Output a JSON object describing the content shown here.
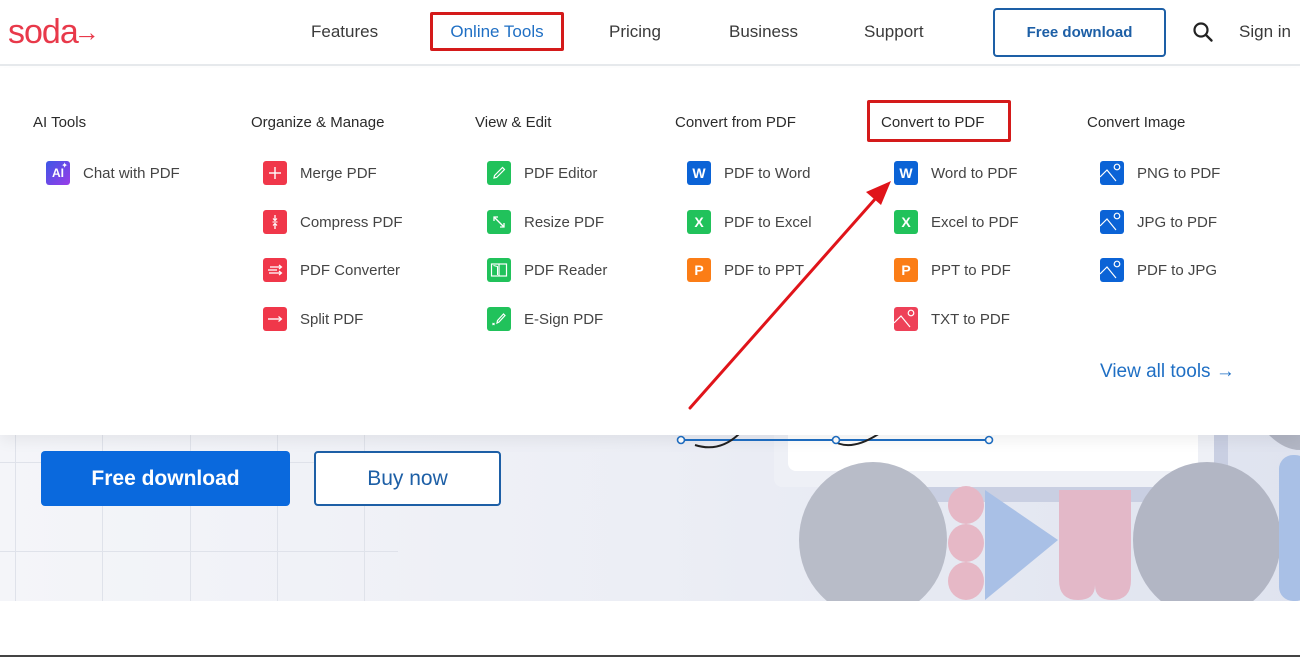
{
  "header": {
    "logo": "soda",
    "logo_arrow": "→",
    "nav": [
      "Features",
      "Online Tools",
      "Pricing",
      "Business",
      "Support"
    ],
    "download_button": "Free download",
    "sign_in": "Sign in"
  },
  "menu": {
    "columns": [
      {
        "title": "AI Tools",
        "items": [
          {
            "label": "Chat with PDF",
            "icon": "ai-icon",
            "glyph": "AI",
            "color": "#5b4be8"
          }
        ]
      },
      {
        "title": "Organize & Manage",
        "items": [
          {
            "label": "Merge PDF",
            "icon": "merge-icon",
            "color": "#f0374a"
          },
          {
            "label": "Compress PDF",
            "icon": "compress-icon",
            "color": "#f0374a"
          },
          {
            "label": "PDF Converter",
            "icon": "converter-icon",
            "color": "#f0374a"
          },
          {
            "label": "Split PDF",
            "icon": "split-icon",
            "color": "#f0374a"
          }
        ]
      },
      {
        "title": "View & Edit",
        "items": [
          {
            "label": "PDF Editor",
            "icon": "pencil-icon",
            "color": "#21c25b"
          },
          {
            "label": "Resize PDF",
            "icon": "resize-icon",
            "color": "#21c25b"
          },
          {
            "label": "PDF Reader",
            "icon": "book-icon",
            "color": "#21c25b"
          },
          {
            "label": "E-Sign PDF",
            "icon": "signature-icon",
            "color": "#21c25b"
          }
        ]
      },
      {
        "title": "Convert from PDF",
        "items": [
          {
            "label": "PDF to Word",
            "icon": "word-icon",
            "glyph": "W",
            "color": "#0b63d6"
          },
          {
            "label": "PDF to Excel",
            "icon": "excel-icon",
            "glyph": "X",
            "color": "#21c25b"
          },
          {
            "label": "PDF to PPT",
            "icon": "ppt-icon",
            "glyph": "P",
            "color": "#fb7d16"
          }
        ]
      },
      {
        "title": "Convert to PDF",
        "items": [
          {
            "label": "Word to PDF",
            "icon": "word-icon",
            "glyph": "W",
            "color": "#0b63d6"
          },
          {
            "label": "Excel to PDF",
            "icon": "excel-icon",
            "glyph": "X",
            "color": "#21c25b"
          },
          {
            "label": "PPT to PDF",
            "icon": "ppt-icon",
            "glyph": "P",
            "color": "#fb7d16"
          },
          {
            "label": "TXT to PDF",
            "icon": "image-icon",
            "color": "#ee4158"
          }
        ]
      },
      {
        "title": "Convert Image",
        "items": [
          {
            "label": "PNG to PDF",
            "icon": "image-icon",
            "color": "#0b63d6"
          },
          {
            "label": "JPG to PDF",
            "icon": "image-icon",
            "color": "#0b63d6"
          },
          {
            "label": "PDF to JPG",
            "icon": "image-icon",
            "color": "#0b63d6"
          }
        ]
      }
    ],
    "view_all": "View all tools →"
  },
  "hero": {
    "free_download": "Free download",
    "buy_now": "Buy now"
  },
  "colors": {
    "brand_red": "#e8394a",
    "link_blue": "#1f6fc4",
    "primary_blue": "#0a69dd",
    "highlight_red": "#d41a1a"
  }
}
